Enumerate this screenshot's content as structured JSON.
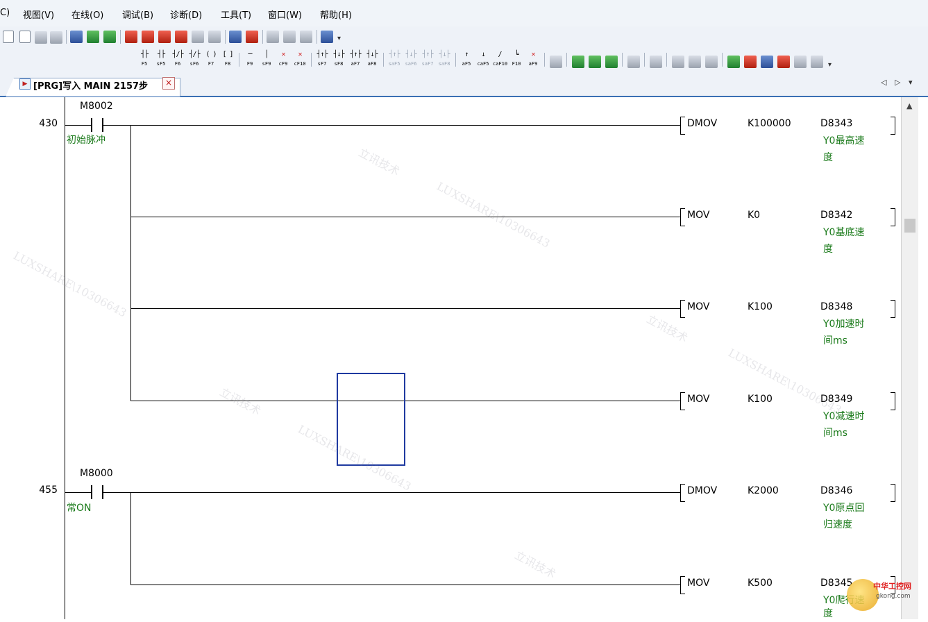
{
  "menu": {
    "items": [
      {
        "label": "C)"
      },
      {
        "label": "视图(V)"
      },
      {
        "label": "在线(O)"
      },
      {
        "label": "调试(B)"
      },
      {
        "label": "诊断(D)"
      },
      {
        "label": "工具(T)"
      },
      {
        "label": "窗口(W)"
      },
      {
        "label": "帮助(H)"
      }
    ]
  },
  "ladder_toolbar": {
    "keys": [
      "F5",
      "sF5",
      "F6",
      "sF6",
      "F7",
      "F8",
      "F9",
      "sF9",
      "cF9",
      "cF10",
      "sF7",
      "sF8",
      "aF7",
      "aF8",
      "saF5",
      "saF6",
      "saF7",
      "saF8",
      "aF5",
      "caF5",
      "caF10",
      "F10",
      "aF9"
    ]
  },
  "tab": {
    "label": "[PRG]写入 MAIN 2157步",
    "close": "×",
    "nav_left": "◁",
    "nav_right": "▷",
    "nav_menu": "▾"
  },
  "ladder": {
    "rungs": [
      {
        "step": "430",
        "contact_device": "M8002",
        "contact_comment": "初始脉冲",
        "instructions": [
          {
            "op": "DMOV",
            "src": "K100000",
            "dst": "D8343",
            "comment": [
              "Y0最高速",
              "度"
            ]
          },
          {
            "op": "MOV",
            "src": "K0",
            "dst": "D8342",
            "comment": [
              "Y0基底速",
              "度"
            ]
          },
          {
            "op": "MOV",
            "src": "K100",
            "dst": "D8348",
            "comment": [
              "Y0加速时",
              "间ms"
            ]
          },
          {
            "op": "MOV",
            "src": "K100",
            "dst": "D8349",
            "comment": [
              "Y0减速时",
              "间ms"
            ]
          }
        ]
      },
      {
        "step": "455",
        "contact_device": "M8000",
        "contact_comment": "常ON",
        "instructions": [
          {
            "op": "DMOV",
            "src": "K2000",
            "dst": "D8346",
            "comment": [
              "Y0原点回",
              "归速度"
            ]
          },
          {
            "op": "MOV",
            "src": "K500",
            "dst": "D8345",
            "comment": [
              "Y0爬行速",
              "度"
            ]
          }
        ]
      }
    ]
  },
  "watermark": {
    "text_cn": "立讯技术",
    "text_en": "LUXSHARE\\10306643"
  },
  "logo": {
    "title": "中华工控网",
    "url": "gkong.com"
  },
  "colors": {
    "comment": "#1a7a1a",
    "cursor": "#1f3aa0",
    "tab_accent": "#3a6fb4"
  }
}
